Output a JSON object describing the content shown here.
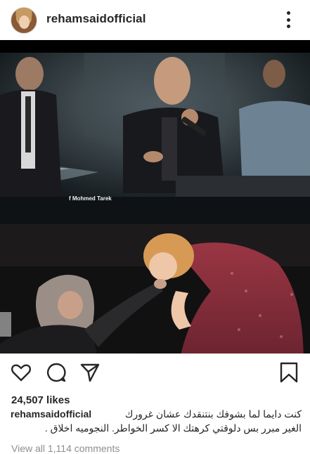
{
  "post": {
    "username": "rehamsaidofficial",
    "watermark": "f Mohmed Tarek",
    "likes": "24,507 likes",
    "caption_user": "rehamsaidofficial",
    "caption_line1": "كنت دايما لما بشوفك  بنتنقدك عشان غرورك",
    "caption_line2": "الغير مبرر بس دلوقتي كرهتك الا كسر الخواطر. النجوميه اخلاق .",
    "view_comments": "View all 1,114 comments"
  },
  "icons": {
    "more": "more-options-icon",
    "like": "heart-icon",
    "comment": "comment-icon",
    "share": "send-icon",
    "save": "bookmark-icon"
  },
  "colors": {
    "text": "#262626",
    "muted": "#8e8e8e",
    "background": "#ffffff"
  }
}
